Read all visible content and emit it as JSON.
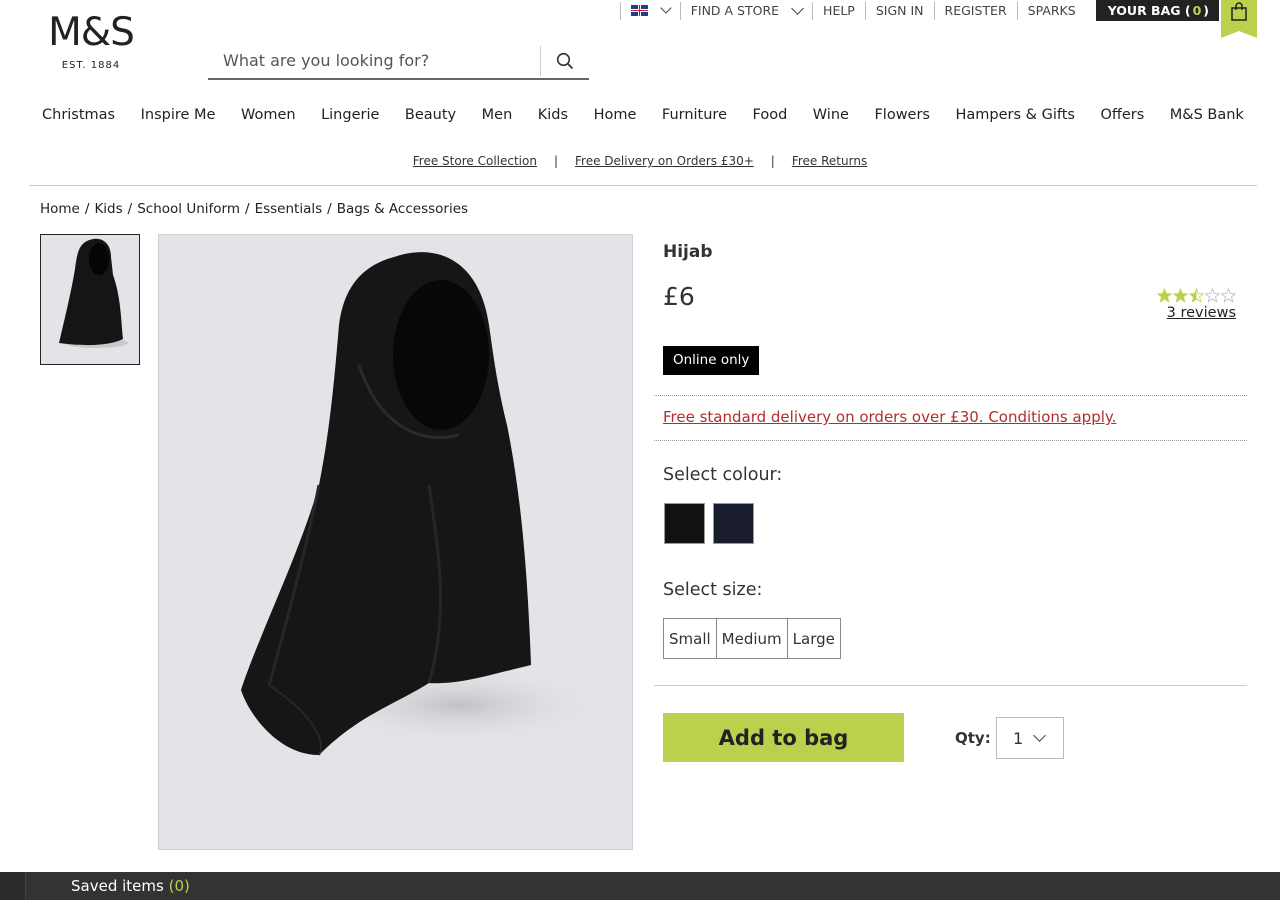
{
  "utility": {
    "find_store": "FIND A STORE",
    "help": "HELP",
    "sign_in": "SIGN IN",
    "register": "REGISTER",
    "sparks": "SPARKS",
    "bag_label_prefix": "YOUR BAG (",
    "bag_count": "0",
    "bag_label_suffix": ")"
  },
  "logo": {
    "mark": "M&S",
    "est": "EST. 1884"
  },
  "search": {
    "placeholder": "What are you looking for?"
  },
  "nav": [
    "Christmas",
    "Inspire Me",
    "Women",
    "Lingerie",
    "Beauty",
    "Men",
    "Kids",
    "Home",
    "Furniture",
    "Food",
    "Wine",
    "Flowers",
    "Hampers & Gifts",
    "Offers",
    "M&S Bank"
  ],
  "promo": [
    "Free Store Collection",
    "Free Delivery on Orders £30+",
    "Free Returns"
  ],
  "breadcrumb": [
    "Home",
    "Kids",
    "School Uniform",
    "Essentials",
    "Bags & Accessories"
  ],
  "product": {
    "title": "Hijab",
    "price": "£6",
    "rating": 2.5,
    "rating_max": 5,
    "reviews": "3 reviews",
    "badge": "Online only",
    "delivery": "Free standard delivery on orders over £30. Conditions apply.",
    "colour_label": "Select colour:",
    "colours": [
      "#111111",
      "#1a1d2b"
    ],
    "size_label": "Select size:",
    "sizes": [
      "Small",
      "Medium",
      "Large"
    ],
    "add_to_bag": "Add to bag",
    "qty_label": "Qty:",
    "qty_value": "1"
  },
  "saved": {
    "label": "Saved items",
    "count": "(0)"
  },
  "colors": {
    "accent": "#b9d14c",
    "link_red": "#b22e2e",
    "dark": "#333333"
  }
}
